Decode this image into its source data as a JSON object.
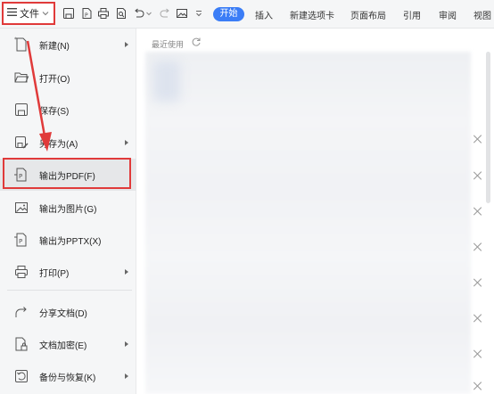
{
  "toolbar": {
    "file_label": "文件",
    "quick_icons": [
      "save-icon",
      "export-pdf-icon",
      "print-icon",
      "print-preview-icon",
      "undo-icon",
      "redo-icon",
      "image-icon",
      "more-icon"
    ],
    "tabs": [
      "开始",
      "插入",
      "新建选项卡",
      "页面布局",
      "引用",
      "审阅",
      "视图"
    ],
    "active_tab": "开始"
  },
  "menu": {
    "items": [
      {
        "label": "新建(N)",
        "icon": "new-document-icon",
        "has_submenu": true
      },
      {
        "label": "打开(O)",
        "icon": "folder-open-icon",
        "has_submenu": false
      },
      {
        "label": "保存(S)",
        "icon": "save-icon",
        "has_submenu": false
      },
      {
        "label": "另存为(A)",
        "icon": "save-as-icon",
        "has_submenu": true
      },
      {
        "label": "输出为PDF(F)",
        "icon": "export-pdf-icon",
        "has_submenu": false,
        "highlighted": true
      },
      {
        "label": "输出为图片(G)",
        "icon": "export-image-icon",
        "has_submenu": false
      },
      {
        "label": "输出为PPTX(X)",
        "icon": "export-pptx-icon",
        "has_submenu": false
      },
      {
        "label": "打印(P)",
        "icon": "print-icon",
        "has_submenu": true
      },
      {
        "label": "分享文档(D)",
        "icon": "share-icon",
        "has_submenu": false
      },
      {
        "label": "文档加密(E)",
        "icon": "encrypt-icon",
        "has_submenu": true
      },
      {
        "label": "备份与恢复(K)",
        "icon": "backup-icon",
        "has_submenu": true
      }
    ]
  },
  "main": {
    "recent_label": "最近使用"
  },
  "colors": {
    "accent": "#3b7df6",
    "annotation_red": "#e03a3a",
    "menu_bg": "#f5f6f7"
  }
}
